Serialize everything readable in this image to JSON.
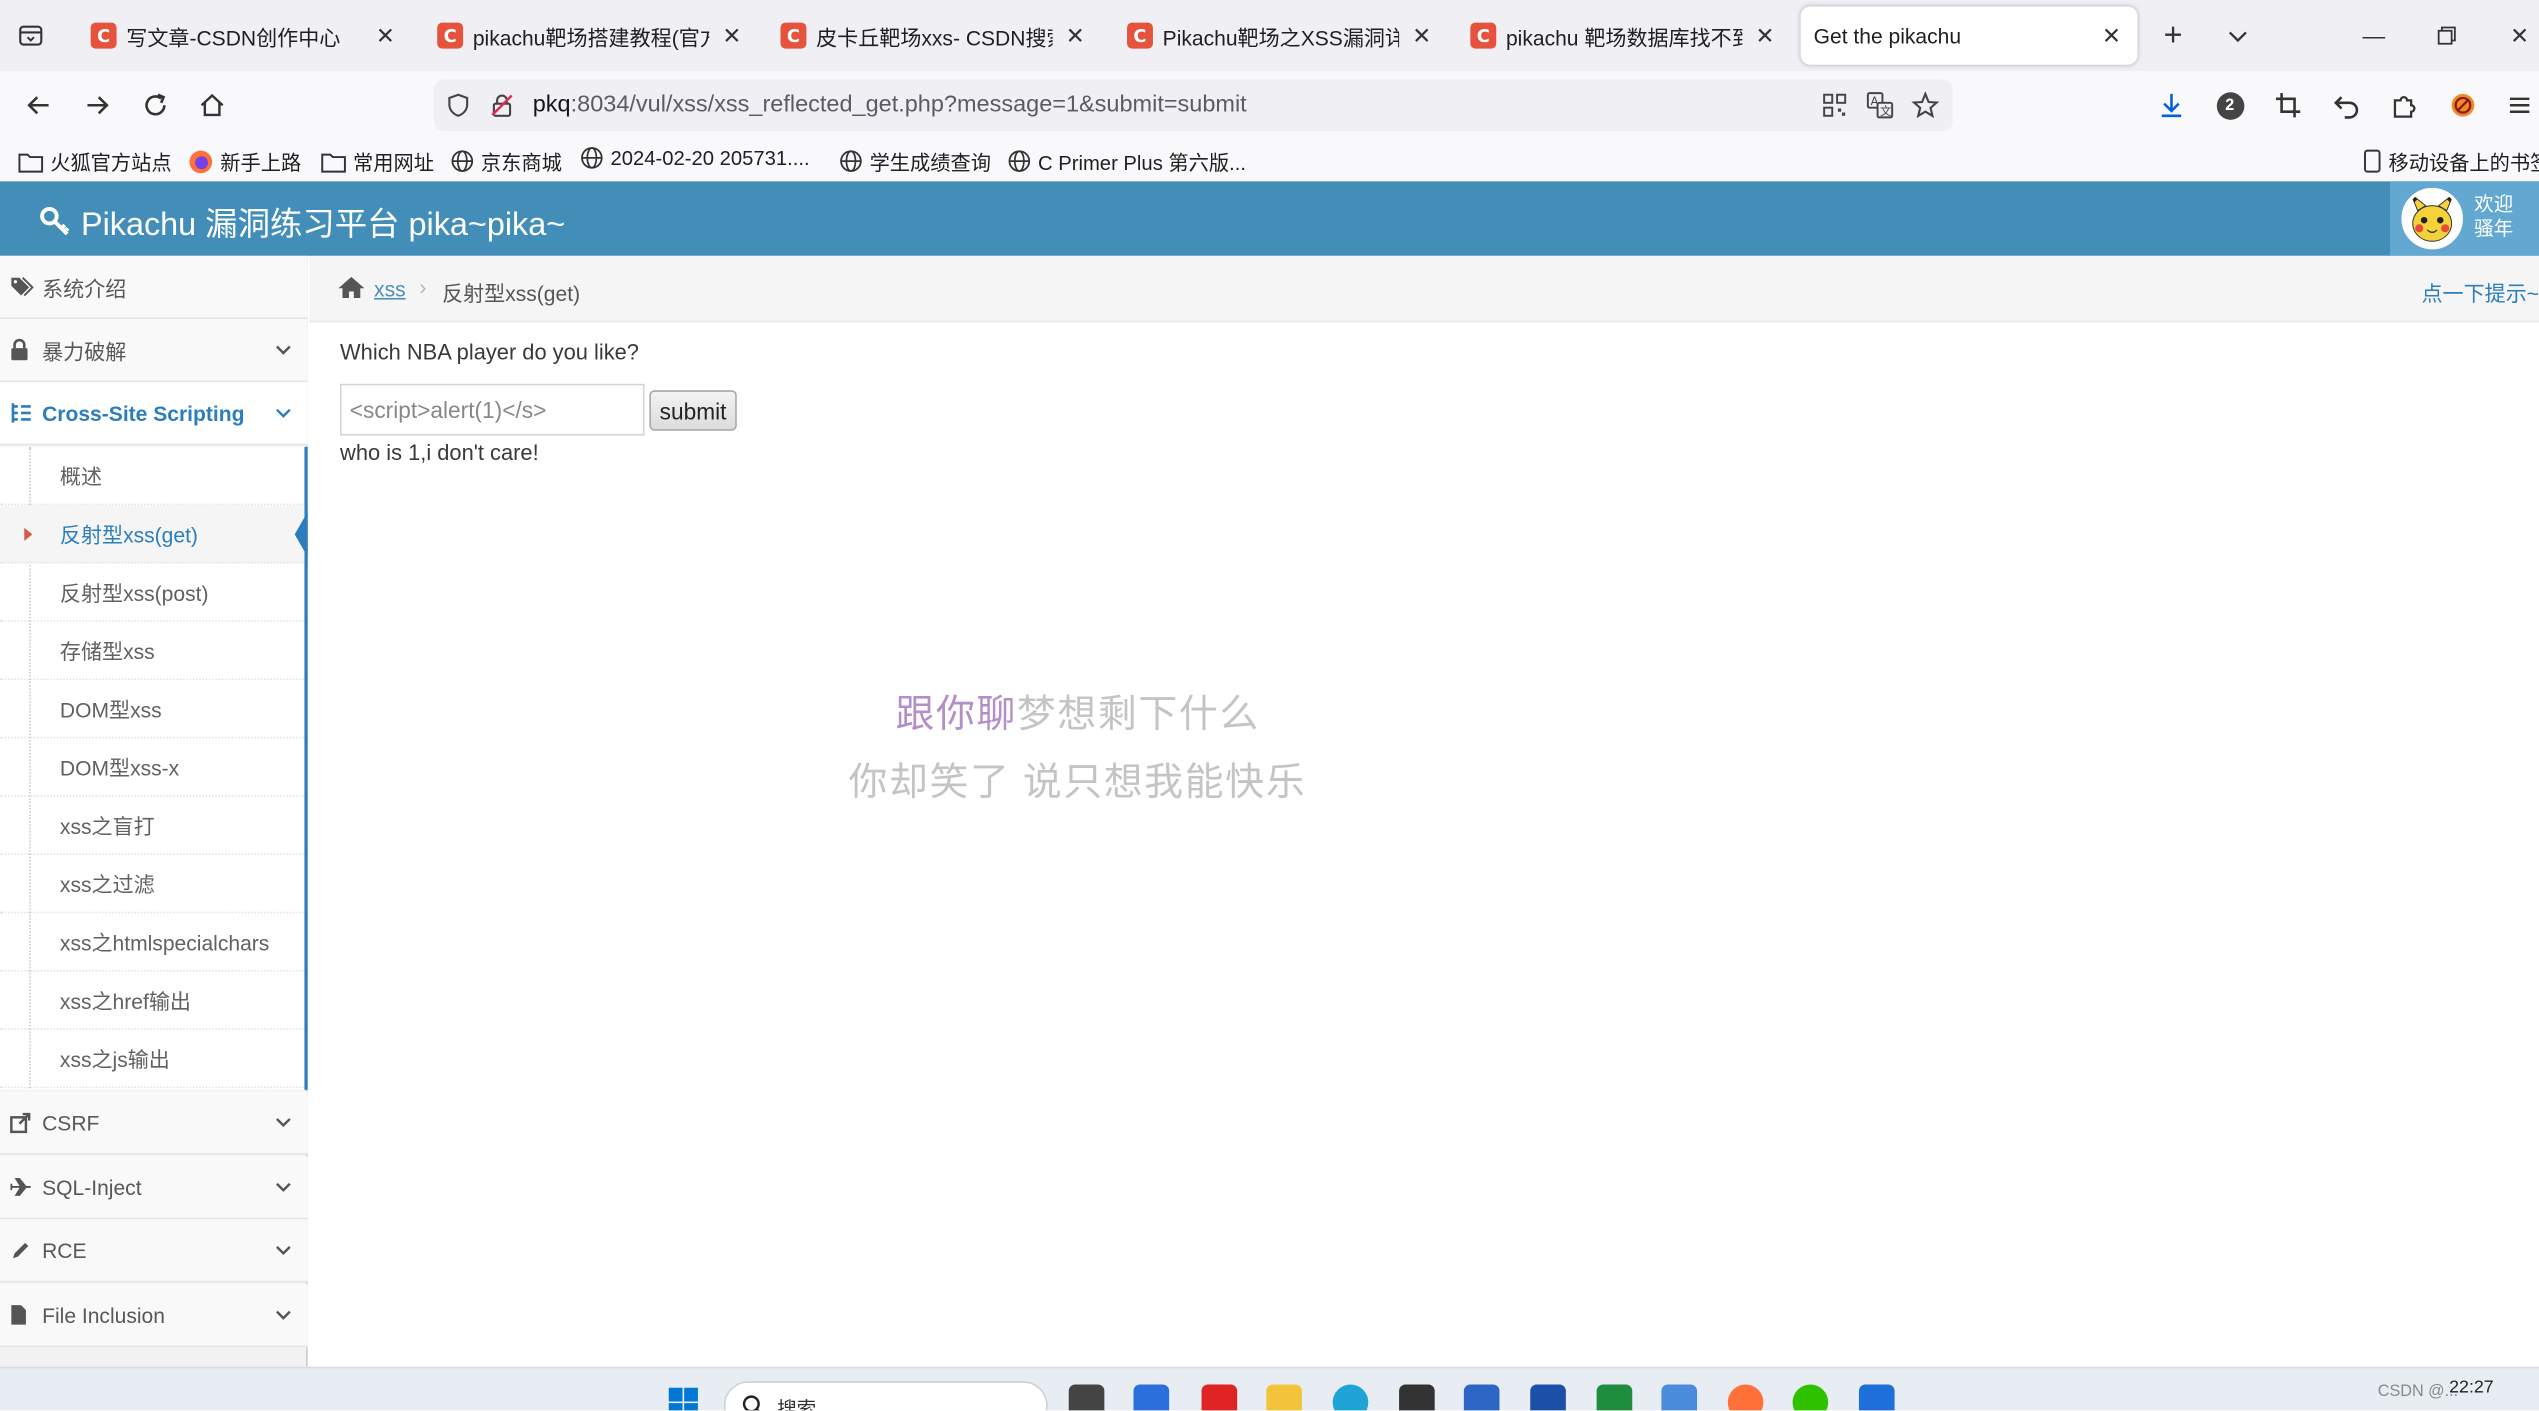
{
  "browser": {
    "tabs": [
      {
        "title": "写文章-CSDN创作中心",
        "favicon": "csdn-icon"
      },
      {
        "title": "pikachu靶场搭建教程(官方题",
        "favicon": "csdn-icon"
      },
      {
        "title": "皮卡丘靶场xxs- CSDN搜索",
        "favicon": "csdn-icon"
      },
      {
        "title": "Pikachu靶场之XSS漏洞详解",
        "favicon": "csdn-icon"
      },
      {
        "title": "pikachu 靶场数据库找不到初",
        "favicon": "csdn-icon"
      },
      {
        "title": "Get the pikachu",
        "favicon": "none"
      }
    ],
    "url_host": "pkq",
    "url_rest": ":8034/vul/xss/xss_reflected_get.php?message=1&submit=submit",
    "extension_badge": "2",
    "bookmarks": [
      {
        "label": "火狐官方站点",
        "icon": "folder-icon"
      },
      {
        "label": "新手上路",
        "icon": "firefox-icon"
      },
      {
        "label": "常用网址",
        "icon": "folder-icon"
      },
      {
        "label": "京东商城",
        "icon": "globe-icon"
      },
      {
        "label": "2024-02-20 205731....",
        "icon": "globe-icon"
      },
      {
        "label": "学生成绩查询",
        "icon": "globe-icon"
      },
      {
        "label": "C Primer Plus 第六版...",
        "icon": "globe-icon"
      }
    ],
    "mobile_bookmarks": "移动设备上的书签"
  },
  "header": {
    "brand": "Pikachu 漏洞练习平台 pika~pika~",
    "welcome_line1": "欢迎",
    "welcome_line2": "骚年"
  },
  "sidebar": {
    "items": [
      {
        "label": "系统介绍",
        "icon": "tags-icon"
      },
      {
        "label": "暴力破解",
        "icon": "lock-icon"
      },
      {
        "label": "Cross-Site Scripting",
        "icon": "list-icon"
      },
      {
        "label": "CSRF",
        "icon": "share-icon"
      },
      {
        "label": "SQL-Inject",
        "icon": "plane-icon"
      },
      {
        "label": "RCE",
        "icon": "pencil-icon"
      },
      {
        "label": "File Inclusion",
        "icon": "file-icon"
      }
    ],
    "xss_submenu": [
      "概述",
      "反射型xss(get)",
      "反射型xss(post)",
      "存储型xss",
      "DOM型xss",
      "DOM型xss-x",
      "xss之盲打",
      "xss之过滤",
      "xss之htmlspecialchars",
      "xss之href输出",
      "xss之js输出"
    ],
    "active_submenu_index": 1
  },
  "breadcrumb": {
    "link": "xss",
    "separator": "›",
    "current": "反射型xss(get)",
    "hint": "点一下提示~"
  },
  "form": {
    "question": "Which NBA player do you like?",
    "input_placeholder": "<script>alert(1)</s>",
    "submit_label": "submit",
    "result": "who is 1,i don't care!"
  },
  "lyrics": {
    "line1_highlight": "跟你聊",
    "line1_rest": "梦想剩下什么",
    "line2": "你却笑了 说只想我能快乐"
  },
  "taskbar": {
    "search_label": "搜索",
    "clock": "22:27",
    "watermark": "CSDN @..."
  },
  "colors": {
    "header_blue": "#438eb9",
    "active_blue": "#2b7dbc",
    "caret_red": "#d15b47"
  }
}
